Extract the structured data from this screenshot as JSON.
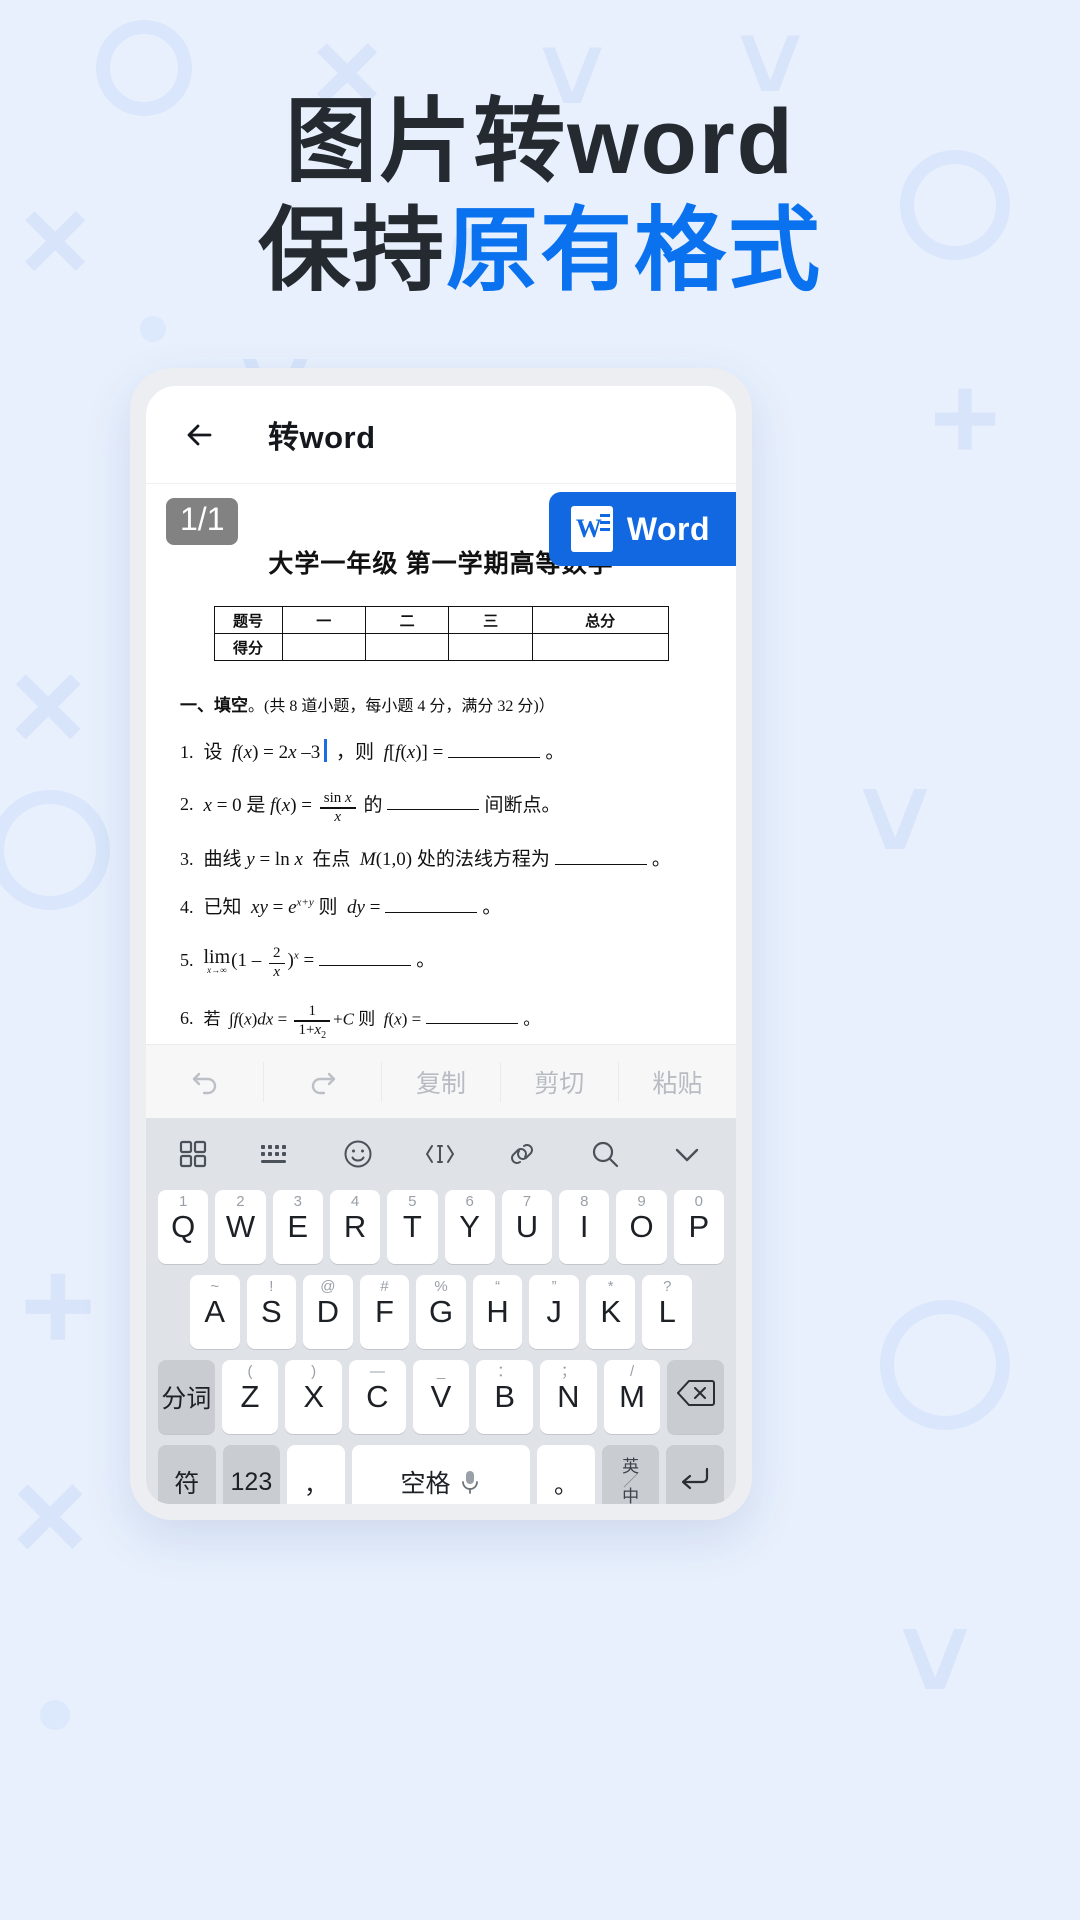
{
  "headline": {
    "line1_a": "图片转",
    "line1_b": "word",
    "line2_a": "保持",
    "line2_b": "原有格式",
    "accent_color": "#0a72ef",
    "text_color": "#252a31"
  },
  "app": {
    "back_icon": "back-arrow-icon",
    "title": "转word"
  },
  "document": {
    "page_badge": "1/1",
    "export_button": {
      "label": "Word",
      "icon": "word-file-icon",
      "color": "#1268e0"
    },
    "title": "大学一年级 第一学期高等数学",
    "score_table": {
      "headers": [
        "题号",
        "一",
        "二",
        "三",
        "总分"
      ],
      "rows": [
        [
          "得分",
          "",
          "",
          "",
          ""
        ]
      ]
    },
    "section_title_bold": "一、填空",
    "section_title_rest": "。(共 8 道小题，每小题 4 分，满分 32 分)）",
    "questions": [
      {
        "num": "1.",
        "text": "设  f(x) = 2x − 3 ，则  f[f(x)] = ______ 。"
      },
      {
        "num": "2.",
        "text": "x = 0 是  f(x) = sin x / x  的 ______ 间断点。"
      },
      {
        "num": "3.",
        "text": "曲线 y = ln x  在点  M(1,0) 处的法线方程为 ______ 。"
      },
      {
        "num": "4.",
        "text": "已知  xy = e^(x+y) 则  dy = ______ 。"
      },
      {
        "num": "5.",
        "text": "lim(x→∞)(1 − 2/x)^x =  ______ 。"
      },
      {
        "num": "6.",
        "text": "若 ∫f(x)dx = 1/(1+x²) + C 则  f(x) = ______ 。"
      }
    ]
  },
  "edit_toolbar": {
    "items": [
      {
        "name": "undo",
        "label": "",
        "icon": "undo-icon"
      },
      {
        "name": "redo",
        "label": "",
        "icon": "redo-icon"
      },
      {
        "name": "copy",
        "label": "复制",
        "icon": ""
      },
      {
        "name": "cut",
        "label": "剪切",
        "icon": ""
      },
      {
        "name": "paste",
        "label": "粘贴",
        "icon": ""
      }
    ]
  },
  "keyboard": {
    "toolbar_icons": [
      "grid-icon",
      "keyboard-icon",
      "emoji-icon",
      "cursor-move-icon",
      "clipboard-link-icon",
      "search-icon",
      "chevron-down-icon"
    ],
    "row1": [
      {
        "key": "Q",
        "hint": "1"
      },
      {
        "key": "W",
        "hint": "2"
      },
      {
        "key": "E",
        "hint": "3"
      },
      {
        "key": "R",
        "hint": "4"
      },
      {
        "key": "T",
        "hint": "5"
      },
      {
        "key": "Y",
        "hint": "6"
      },
      {
        "key": "U",
        "hint": "7"
      },
      {
        "key": "I",
        "hint": "8"
      },
      {
        "key": "O",
        "hint": "9"
      },
      {
        "key": "P",
        "hint": "0"
      }
    ],
    "row2": [
      {
        "key": "A",
        "hint": "~"
      },
      {
        "key": "S",
        "hint": "!"
      },
      {
        "key": "D",
        "hint": "@"
      },
      {
        "key": "F",
        "hint": "#"
      },
      {
        "key": "G",
        "hint": "%"
      },
      {
        "key": "H",
        "hint": "“"
      },
      {
        "key": "J",
        "hint": "”"
      },
      {
        "key": "K",
        "hint": "*"
      },
      {
        "key": "L",
        "hint": "?"
      }
    ],
    "row3_left": "分词",
    "row3": [
      {
        "key": "Z",
        "hint": "("
      },
      {
        "key": "X",
        "hint": ")"
      },
      {
        "key": "C",
        "hint": "—"
      },
      {
        "key": "V",
        "hint": "_"
      },
      {
        "key": "B",
        "hint": "："
      },
      {
        "key": "N",
        "hint": "；"
      },
      {
        "key": "M",
        "hint": "/"
      }
    ],
    "row3_right_icon": "backspace-icon",
    "row4": {
      "symbol": "符",
      "numbers": "123",
      "comma": "，",
      "space": "空格",
      "space_icon": "microphone-icon",
      "period": "。",
      "lang_top": "英",
      "lang_bottom": "中",
      "enter_icon": "enter-icon"
    }
  }
}
